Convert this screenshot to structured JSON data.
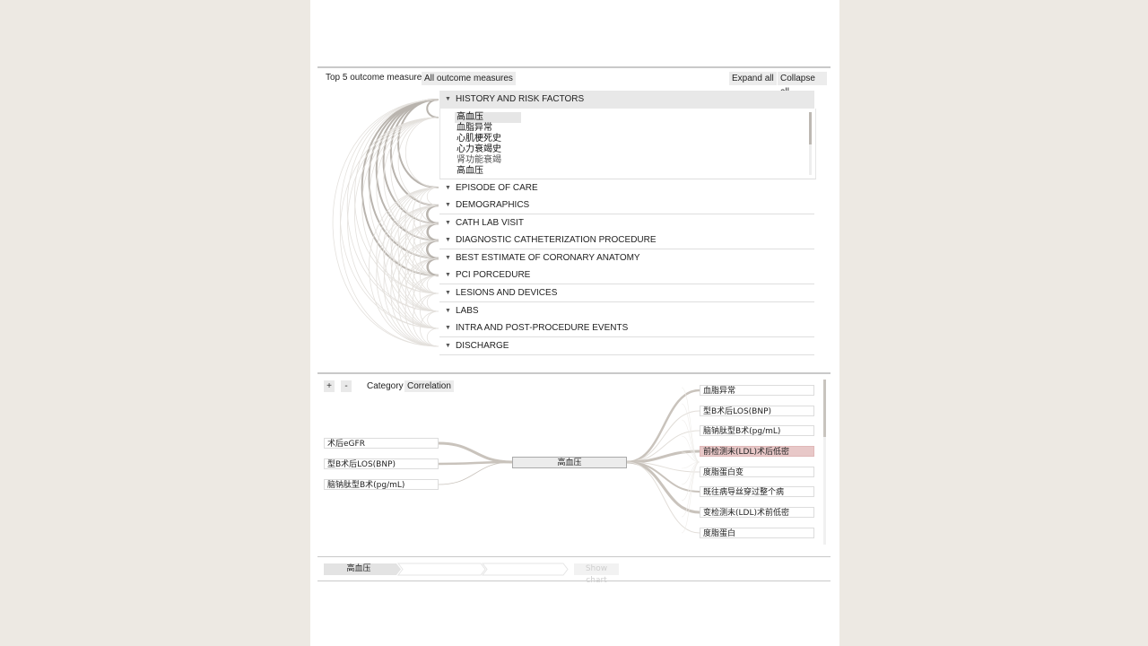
{
  "topbar": {
    "label": "Top 5 outcome measures",
    "all_button": "All outcome measures",
    "expand_all": "Expand all",
    "collapse_all": "Collapse all"
  },
  "sections": {
    "history": "HISTORY AND RISK FACTORS",
    "episode": "EPISODE OF CARE",
    "demographics": "DEMOGRAPHICS",
    "cath": "CATH LAB VISIT",
    "diagnostic": "DIAGNOSTIC CATHETERIZATION PROCEDURE",
    "best": "BEST ESTIMATE OF CORONARY ANATOMY",
    "pci": "PCI PORCEDURE",
    "lesions": "LESIONS AND DEVICES",
    "labs": "LABS",
    "intra": "INTRA AND POST-PROCEDURE EVENTS",
    "discharge": "DISCHARGE"
  },
  "history_items": [
    "高血压",
    "血脂异常",
    "心肌梗死史",
    "心力衰竭史",
    "肾功能衰竭",
    "高血压"
  ],
  "graph": {
    "plus": "+",
    "minus": "-",
    "category_label": "Category",
    "category_value": "Correlation",
    "center": "高血压",
    "left_nodes": [
      "术后eGFR",
      "型B术后LOS(BNP)",
      "脑钠肽型B术(pg/mL)"
    ],
    "right_nodes": [
      "血脂异常",
      "型B术后LOS(BNP)",
      "脑钠肽型B术(pg/mL)",
      "前检测未(LDL)术后低密",
      "度脂蛋白变",
      "既往病导丝穿过整个病",
      "变检测未(LDL)术前低密",
      "度脂蛋白"
    ],
    "highlight_color": "#e8c8c8"
  },
  "breadcrumb": {
    "step1": "高血压",
    "show_chart": "Show chart"
  },
  "icons": [
    "caret-down-icon"
  ]
}
